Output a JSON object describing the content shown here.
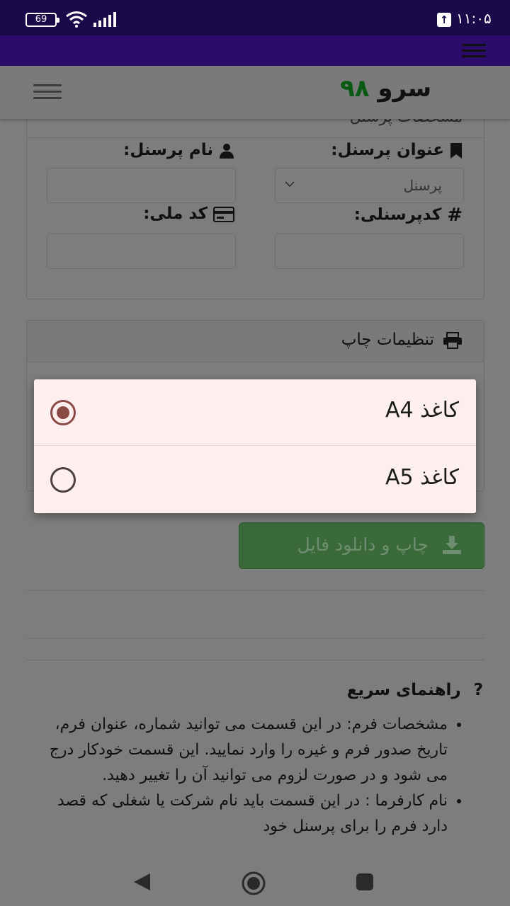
{
  "status_bar": {
    "battery": "69",
    "time": "۱۱:۰۵"
  },
  "header": {
    "logo_word": "سرو",
    "logo_number": "۹۸"
  },
  "personnel_card": {
    "title": "مشخصات پرسنل",
    "fields": {
      "title_label": "عنوان پرسنل:",
      "title_select_value": "پرسنل",
      "name_label": "نام پرسنل:",
      "name_value": "",
      "code_label": "کدپرسنلی:",
      "code_value": "",
      "national_id_label": "کد ملی:",
      "national_id_value": ""
    }
  },
  "print_card": {
    "title": "تنظیمات چاپ"
  },
  "print_button": {
    "label": "چاپ و دانلود فایل"
  },
  "help": {
    "title": "راهنمای سریع",
    "items": [
      "مشخصات فرم: در این قسمت می توانید شماره، عنوان فرم، تاریخ صدور فرم و غیره را وارد نمایید. این قسمت خودکار درج می شود و در صورت لزوم می توانید آن را تغییر دهید.",
      "نام کارفرما : در این قسمت باید نام شرکت یا شغلی که قصد دارد فرم را برای پرسنل خود"
    ]
  },
  "paper_dialog": {
    "options": [
      {
        "label": "کاغذ A4",
        "selected": true
      },
      {
        "label": "کاغذ A5",
        "selected": false
      }
    ]
  },
  "colors": {
    "status_bar": "#1b0a4a",
    "app_bar": "#2c0c6b",
    "logo_number": "#0a5a14",
    "dialog_bg": "#fcefee",
    "radio_accent": "#8b4a44",
    "print_button": "#3a6a3a"
  },
  "icons": {
    "battery": "battery-icon",
    "wifi": "wifi-icon",
    "signal": "signal-icon",
    "upload": "upload-icon",
    "menu": "menu-icon",
    "bookmark": "bookmark-icon",
    "user": "user-icon",
    "hash": "hash-icon",
    "card": "id-card-icon",
    "printer": "printer-icon",
    "download": "download-icon",
    "question": "question-icon"
  }
}
